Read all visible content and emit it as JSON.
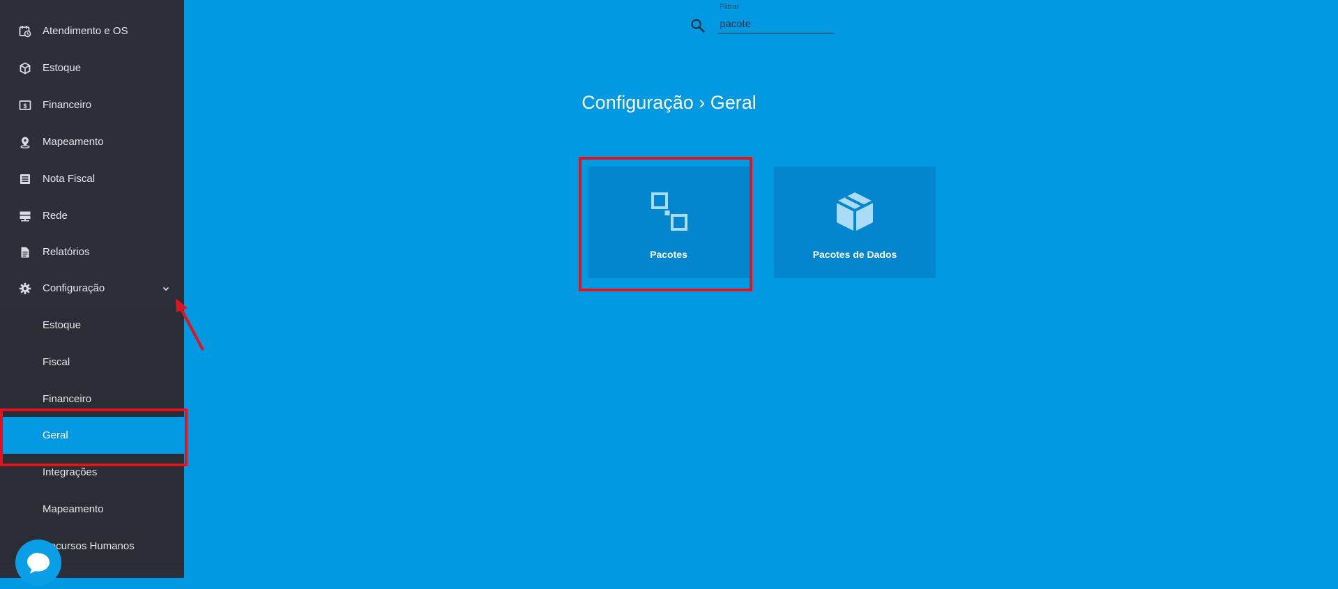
{
  "sidebar": {
    "items": [
      {
        "label": "Atendimento e OS",
        "icon": "calendar-clock-icon"
      },
      {
        "label": "Estoque",
        "icon": "cube-icon"
      },
      {
        "label": "Financeiro",
        "icon": "money-icon"
      },
      {
        "label": "Mapeamento",
        "icon": "map-pin-icon"
      },
      {
        "label": "Nota Fiscal",
        "icon": "document-list-icon"
      },
      {
        "label": "Rede",
        "icon": "server-icon"
      },
      {
        "label": "Relatórios",
        "icon": "report-icon"
      },
      {
        "label": "Configuração",
        "icon": "gear-icon",
        "expanded": true
      }
    ],
    "subitems": [
      {
        "label": "Estoque"
      },
      {
        "label": "Fiscal"
      },
      {
        "label": "Financeiro"
      },
      {
        "label": "Geral",
        "active": true
      },
      {
        "label": "Integrações"
      },
      {
        "label": "Mapeamento"
      },
      {
        "label": "Recursos Humanos"
      }
    ]
  },
  "search": {
    "label": "Filtrar",
    "value": "pacote"
  },
  "page_title": "Configuração › Geral",
  "cards": [
    {
      "label": "Pacotes",
      "icon": "packages-icon"
    },
    {
      "label": "Pacotes de Dados",
      "icon": "box-icon"
    }
  ],
  "colors": {
    "sidebar_bg": "#2c2f3a",
    "main_bg": "#0299e3",
    "card_bg": "#0386ce",
    "active_item": "#0399e3",
    "annotation_red": "#e0141e"
  }
}
